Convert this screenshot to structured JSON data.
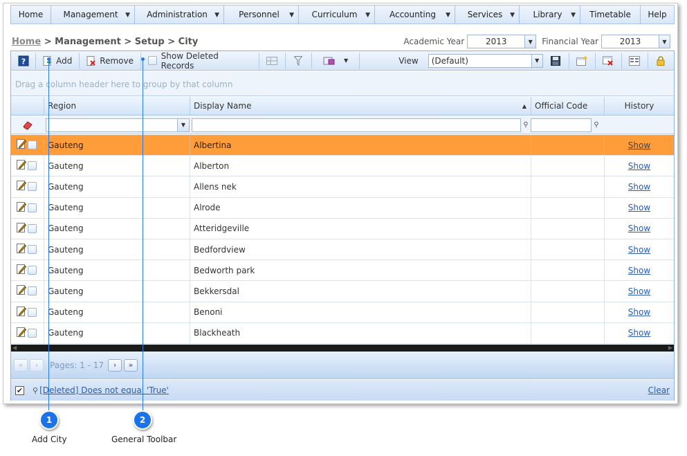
{
  "menu": [
    {
      "label": "Home",
      "dropdown": false
    },
    {
      "label": "Management",
      "dropdown": true
    },
    {
      "label": "Administration",
      "dropdown": true
    },
    {
      "label": "Personnel",
      "dropdown": true
    },
    {
      "label": "Curriculum",
      "dropdown": true
    },
    {
      "label": "Accounting",
      "dropdown": true
    },
    {
      "label": "Services",
      "dropdown": true
    },
    {
      "label": "Library",
      "dropdown": true
    },
    {
      "label": "Timetable",
      "dropdown": false
    },
    {
      "label": "Help",
      "dropdown": false
    }
  ],
  "breadcrumb": {
    "home": "Home",
    "path": " > Management > Setup > City"
  },
  "years": {
    "academic_label": "Academic Year",
    "academic_value": "2013",
    "financial_label": "Financial Year",
    "financial_value": "2013"
  },
  "toolbar": {
    "add_label": "Add",
    "remove_label": "Remove",
    "show_deleted_label": "Show Deleted Records",
    "view_label": "View",
    "view_value": "(Default)"
  },
  "group_panel_text": "Drag a column header here to group by that column",
  "columns": {
    "region": "Region",
    "display_name": "Display Name",
    "official_code": "Official Code",
    "history": "History"
  },
  "rows": [
    {
      "region": "Gauteng",
      "name": "Albertina",
      "code": "",
      "history": "Show",
      "selected": true
    },
    {
      "region": "Gauteng",
      "name": "Alberton",
      "code": "",
      "history": "Show",
      "selected": false
    },
    {
      "region": "Gauteng",
      "name": "Allens nek",
      "code": "",
      "history": "Show",
      "selected": false
    },
    {
      "region": "Gauteng",
      "name": "Alrode",
      "code": "",
      "history": "Show",
      "selected": false
    },
    {
      "region": "Gauteng",
      "name": "Atteridgeville",
      "code": "",
      "history": "Show",
      "selected": false
    },
    {
      "region": "Gauteng",
      "name": "Bedfordview",
      "code": "",
      "history": "Show",
      "selected": false
    },
    {
      "region": "Gauteng",
      "name": "Bedworth park",
      "code": "",
      "history": "Show",
      "selected": false
    },
    {
      "region": "Gauteng",
      "name": "Bekkersdal",
      "code": "",
      "history": "Show",
      "selected": false
    },
    {
      "region": "Gauteng",
      "name": "Benoni",
      "code": "",
      "history": "Show",
      "selected": false
    },
    {
      "region": "Gauteng",
      "name": "Blackheath",
      "code": "",
      "history": "Show",
      "selected": false
    }
  ],
  "pager": {
    "text": "Pages: 1 - 17"
  },
  "filter_status": {
    "checked": true,
    "expression": "[Deleted] Does not equal 'True'",
    "clear_label": "Clear"
  },
  "callouts": [
    {
      "number": "1",
      "label": "Add City"
    },
    {
      "number": "2",
      "label": "General Toolbar"
    }
  ],
  "colors": {
    "selected_row": "#ff9d3b",
    "link": "#2a5db0",
    "callout": "#1a73e8"
  }
}
